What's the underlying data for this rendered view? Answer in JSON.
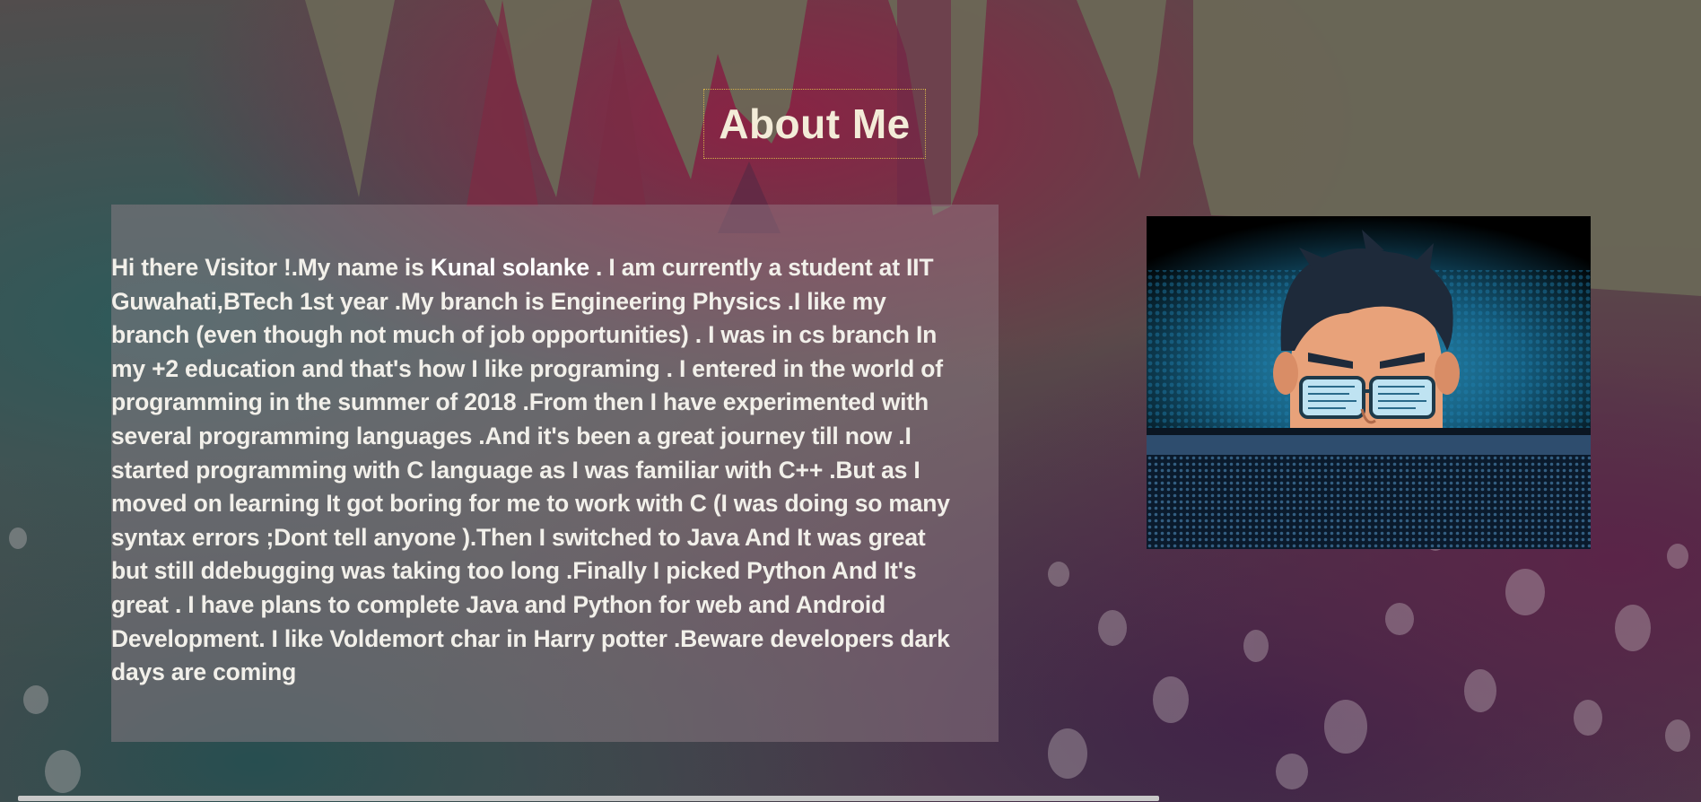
{
  "page": {
    "title": "About Me"
  },
  "about": {
    "intro_before_name": "Hi there Visitor !.My name is ",
    "name": "Kunal solanke",
    "intro_after_name": " . I am currently a student at IIT Guwahati,BTech 1st year .My branch is Engineering Physics .I like my branch (even though not much of job opportunities) . I was in cs branch In my +2 education and that's how I like programing . I entered in the world of programming in the summer of 2018 .From then I have experimented with several programming languages .And it's been a great journey till now .I started programming with C language as I was familiar with C++ .But as I moved on learning It got boring for me to work with C (I was doing so many syntax errors ;Dont tell anyone ).Then I switched to Java And It was great but still ddebugging was taking too long .Finally I picked Python And It's great . I have plans to complete Java and Python for web and Android Development. I like Voldemort char in Harry potter .Beware developers dark days are coming"
  },
  "image": {
    "icon": "programmer-portrait-illustration"
  },
  "colors": {
    "title_border": "#d4b24a",
    "title_text": "#f3ecd8",
    "panel_bg": "rgba(150,130,140,0.45)",
    "body_text": "#f2f0ea"
  }
}
